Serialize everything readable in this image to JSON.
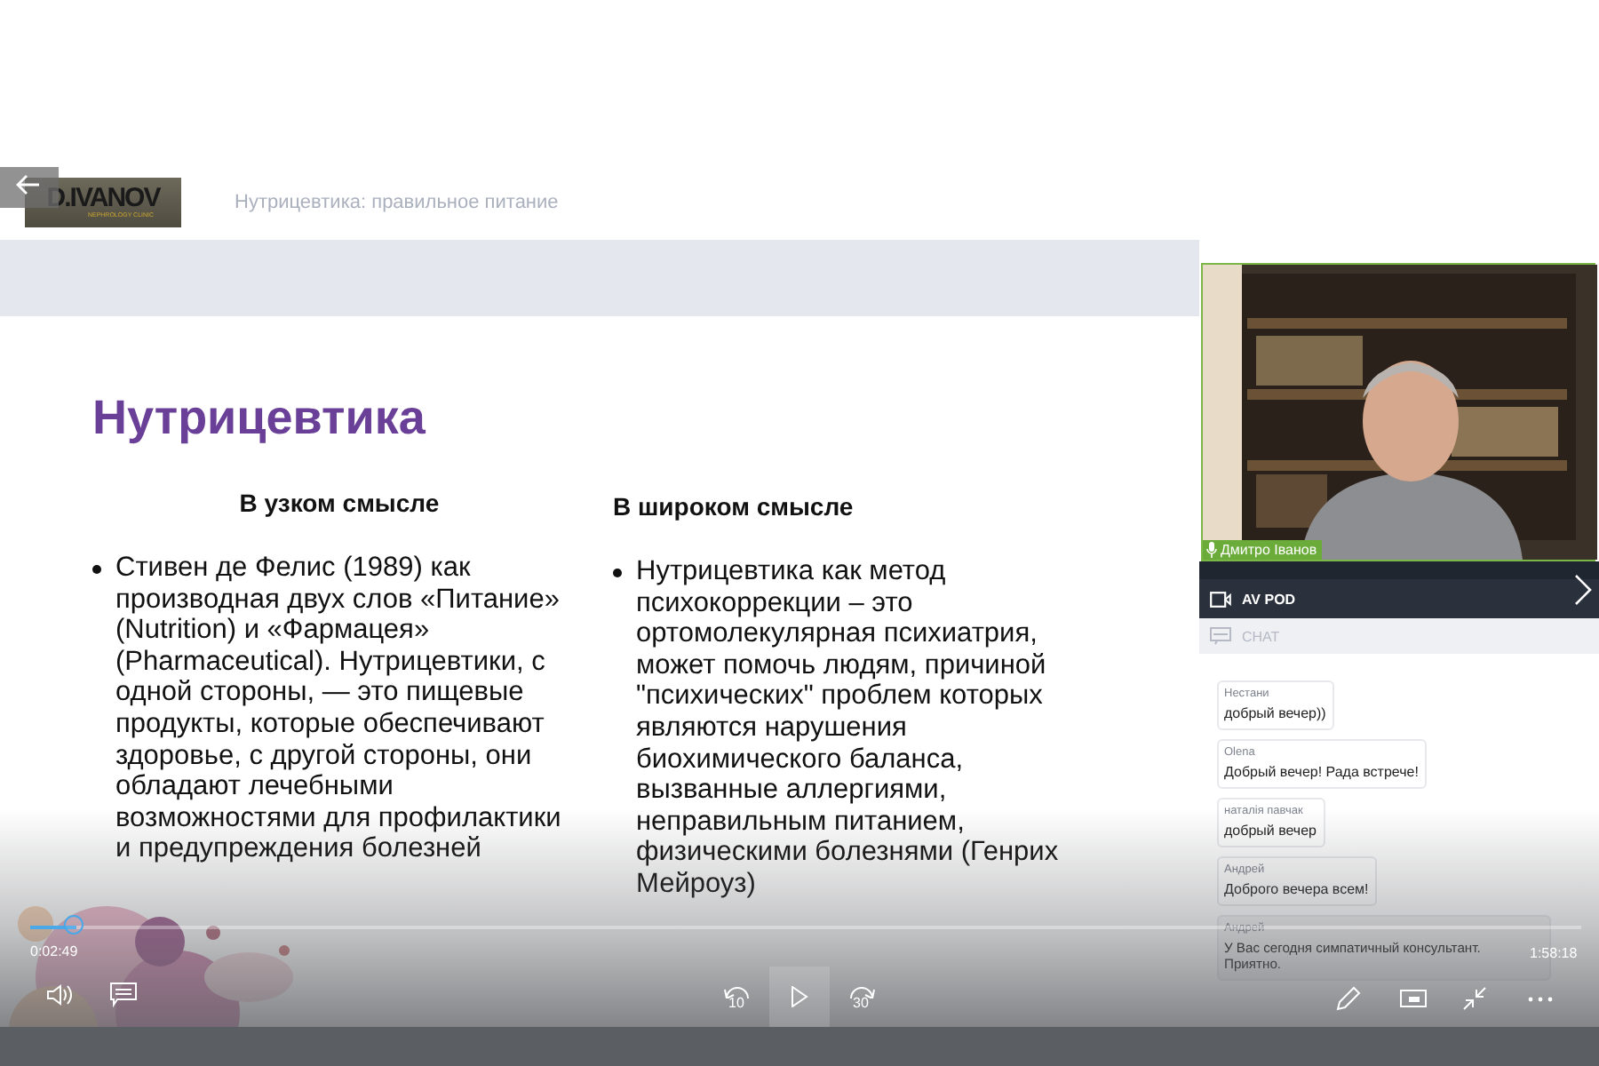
{
  "header": {
    "logo": {
      "title": "D.IVANOV",
      "subtitle": "NEPHROLOGY CLINIC"
    },
    "title": "Нутрицевтика: правильное питание"
  },
  "slide": {
    "title": "Нутрицевтика",
    "columns": [
      {
        "heading": "В узком смысле",
        "bullets": [
          "Стивен де Фелис (1989) как производная двух слов «Питание» (Nutrition) и «Фармацея» (Pharmaceutical). Нутрицевтики, с одной стороны, — это пищевые продукты, которые обеспечивают здоровье, с другой стороны, они обладают лечебными возможностями для профилактики и предупреждения болезней"
        ]
      },
      {
        "heading": "В широком смысле",
        "bullets": [
          "Нутрицевтика как метод психокоррекции – это ортомолекулярная психиатрия, может помочь людям, причиной \"психических\" проблем которых являются нарушения биохимического баланса, вызванные аллергиями, неправильным питанием, физическими болезнями (Генрих Мейроуз)"
        ]
      }
    ]
  },
  "webcam": {
    "speaker": "Дмитро Іванов"
  },
  "av_pod": {
    "title": "AV POD"
  },
  "chat": {
    "title": "CHAT",
    "messages": [
      {
        "author": "Нестани",
        "text": "добрый вечер))"
      },
      {
        "author": "Olena",
        "text": "Добрый вечер! Рада встрече!"
      },
      {
        "author": "наталія павчак",
        "text": "добрый вечер"
      },
      {
        "author": "Андрей",
        "text": "Доброго вечера всем!"
      },
      {
        "author": "Андрей",
        "text": "У Вас сегодня симпатичный консультант. Приятно."
      }
    ]
  },
  "player": {
    "elapsed": "0:02:49",
    "level": 0.03,
    "playing": false,
    "rewind_label": "10",
    "forward_label": "30",
    "duration": "1:58:18"
  }
}
